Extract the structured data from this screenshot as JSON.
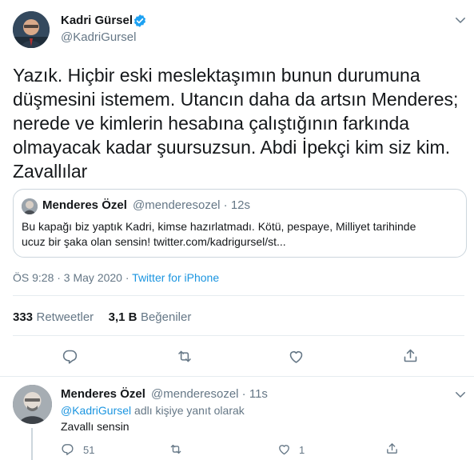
{
  "main_tweet": {
    "author_name": "Kadri Gürsel",
    "author_handle": "@KadriGursel",
    "verified_icon": "verified-badge-icon",
    "text_lines": [
      "Yazık. Hiçbir eski meslektaşımın bunun durumuna",
      "düşmesini istemem. Utancın daha da artsın Menderes;",
      "nerede ve kimlerin hesabına çalıştığının farkında",
      "olmayacak kadar şuursuzsun. Abdi İpekçi kim siz kim.",
      "Zavallılar"
    ],
    "quote": {
      "author_name": "Menderes Özel",
      "author_handle": "@menderesozel",
      "separator": "·",
      "time": "12s",
      "text_lines": [
        "Bu kapağı biz yaptık Kadri, kimse hazırlatmadı. Kötü, pespaye, Milliyet tarihinde",
        "ucuz bir şaka olan sensin! twitter.com/kadrigursel/st..."
      ]
    },
    "timestamp": "ÖS 9:28 · 3 May 2020",
    "source_separator": "·",
    "source": "Twitter for iPhone",
    "stats": {
      "retweets_count": "333",
      "retweets_label": "Retweetler",
      "likes_count": "3,1 B",
      "likes_label": "Beğeniler"
    }
  },
  "reply_tweet": {
    "author_name": "Menderes Özel",
    "author_handle": "@menderesozel",
    "separator": "·",
    "time": "11s",
    "reply_to_handle": "@KadriGursel",
    "reply_to_suffix": "adlı kişiye yanıt olarak",
    "text": "Zavallı sensin",
    "counts": {
      "replies": "51",
      "likes": "1"
    }
  },
  "colors": {
    "accent": "#1b95e0",
    "muted": "#657786",
    "border": "#e6ecf0"
  }
}
